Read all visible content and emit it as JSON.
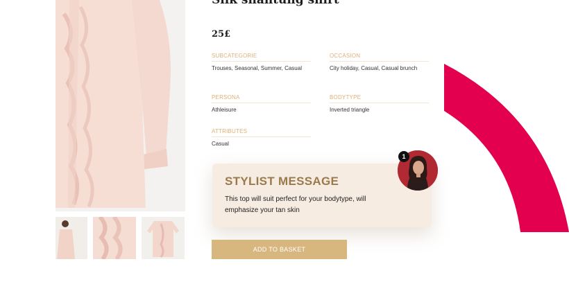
{
  "product": {
    "title": "Silk shantung shirt",
    "price": "25£"
  },
  "attributes": {
    "subcategorie": {
      "label": "SUBCATEGORIE",
      "value": "Trouses, Seasonal, Summer, Casual"
    },
    "occasion": {
      "label": "OCCASION",
      "value": "City holiday, Casual, Casual brunch"
    },
    "persona": {
      "label": "PERSONA",
      "value": "Athleisure"
    },
    "bodytype": {
      "label": "BODYTYPE",
      "value": "Inverted triangle"
    },
    "attributes": {
      "label": "ATTRIBUTES",
      "value": "Casual"
    }
  },
  "stylist": {
    "title": "STYLIST MESSAGE",
    "message": "This top will suit perfect for your bodytype, will emphasize your tan skin",
    "badge_count": "1"
  },
  "actions": {
    "add_to_basket": "ADD TO BASKET"
  },
  "colors": {
    "accent_gold": "#d8b77f",
    "label_gold": "#e0b078",
    "arc_magenta": "#e3004f",
    "card_bg": "#f7ece1"
  },
  "icons": {
    "badge": "notification-badge",
    "avatar": "stylist-avatar"
  }
}
